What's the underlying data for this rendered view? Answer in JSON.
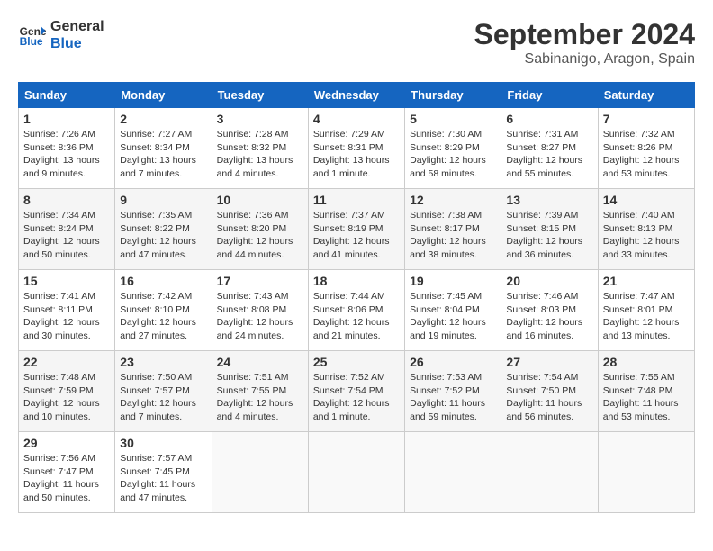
{
  "header": {
    "logo_line1": "General",
    "logo_line2": "Blue",
    "month": "September 2024",
    "location": "Sabinanigo, Aragon, Spain"
  },
  "columns": [
    "Sunday",
    "Monday",
    "Tuesday",
    "Wednesday",
    "Thursday",
    "Friday",
    "Saturday"
  ],
  "weeks": [
    [
      {
        "day": "1",
        "info": "Sunrise: 7:26 AM\nSunset: 8:36 PM\nDaylight: 13 hours\nand 9 minutes."
      },
      {
        "day": "2",
        "info": "Sunrise: 7:27 AM\nSunset: 8:34 PM\nDaylight: 13 hours\nand 7 minutes."
      },
      {
        "day": "3",
        "info": "Sunrise: 7:28 AM\nSunset: 8:32 PM\nDaylight: 13 hours\nand 4 minutes."
      },
      {
        "day": "4",
        "info": "Sunrise: 7:29 AM\nSunset: 8:31 PM\nDaylight: 13 hours\nand 1 minute."
      },
      {
        "day": "5",
        "info": "Sunrise: 7:30 AM\nSunset: 8:29 PM\nDaylight: 12 hours\nand 58 minutes."
      },
      {
        "day": "6",
        "info": "Sunrise: 7:31 AM\nSunset: 8:27 PM\nDaylight: 12 hours\nand 55 minutes."
      },
      {
        "day": "7",
        "info": "Sunrise: 7:32 AM\nSunset: 8:26 PM\nDaylight: 12 hours\nand 53 minutes."
      }
    ],
    [
      {
        "day": "8",
        "info": "Sunrise: 7:34 AM\nSunset: 8:24 PM\nDaylight: 12 hours\nand 50 minutes."
      },
      {
        "day": "9",
        "info": "Sunrise: 7:35 AM\nSunset: 8:22 PM\nDaylight: 12 hours\nand 47 minutes."
      },
      {
        "day": "10",
        "info": "Sunrise: 7:36 AM\nSunset: 8:20 PM\nDaylight: 12 hours\nand 44 minutes."
      },
      {
        "day": "11",
        "info": "Sunrise: 7:37 AM\nSunset: 8:19 PM\nDaylight: 12 hours\nand 41 minutes."
      },
      {
        "day": "12",
        "info": "Sunrise: 7:38 AM\nSunset: 8:17 PM\nDaylight: 12 hours\nand 38 minutes."
      },
      {
        "day": "13",
        "info": "Sunrise: 7:39 AM\nSunset: 8:15 PM\nDaylight: 12 hours\nand 36 minutes."
      },
      {
        "day": "14",
        "info": "Sunrise: 7:40 AM\nSunset: 8:13 PM\nDaylight: 12 hours\nand 33 minutes."
      }
    ],
    [
      {
        "day": "15",
        "info": "Sunrise: 7:41 AM\nSunset: 8:11 PM\nDaylight: 12 hours\nand 30 minutes."
      },
      {
        "day": "16",
        "info": "Sunrise: 7:42 AM\nSunset: 8:10 PM\nDaylight: 12 hours\nand 27 minutes."
      },
      {
        "day": "17",
        "info": "Sunrise: 7:43 AM\nSunset: 8:08 PM\nDaylight: 12 hours\nand 24 minutes."
      },
      {
        "day": "18",
        "info": "Sunrise: 7:44 AM\nSunset: 8:06 PM\nDaylight: 12 hours\nand 21 minutes."
      },
      {
        "day": "19",
        "info": "Sunrise: 7:45 AM\nSunset: 8:04 PM\nDaylight: 12 hours\nand 19 minutes."
      },
      {
        "day": "20",
        "info": "Sunrise: 7:46 AM\nSunset: 8:03 PM\nDaylight: 12 hours\nand 16 minutes."
      },
      {
        "day": "21",
        "info": "Sunrise: 7:47 AM\nSunset: 8:01 PM\nDaylight: 12 hours\nand 13 minutes."
      }
    ],
    [
      {
        "day": "22",
        "info": "Sunrise: 7:48 AM\nSunset: 7:59 PM\nDaylight: 12 hours\nand 10 minutes."
      },
      {
        "day": "23",
        "info": "Sunrise: 7:50 AM\nSunset: 7:57 PM\nDaylight: 12 hours\nand 7 minutes."
      },
      {
        "day": "24",
        "info": "Sunrise: 7:51 AM\nSunset: 7:55 PM\nDaylight: 12 hours\nand 4 minutes."
      },
      {
        "day": "25",
        "info": "Sunrise: 7:52 AM\nSunset: 7:54 PM\nDaylight: 12 hours\nand 1 minute."
      },
      {
        "day": "26",
        "info": "Sunrise: 7:53 AM\nSunset: 7:52 PM\nDaylight: 11 hours\nand 59 minutes."
      },
      {
        "day": "27",
        "info": "Sunrise: 7:54 AM\nSunset: 7:50 PM\nDaylight: 11 hours\nand 56 minutes."
      },
      {
        "day": "28",
        "info": "Sunrise: 7:55 AM\nSunset: 7:48 PM\nDaylight: 11 hours\nand 53 minutes."
      }
    ],
    [
      {
        "day": "29",
        "info": "Sunrise: 7:56 AM\nSunset: 7:47 PM\nDaylight: 11 hours\nand 50 minutes."
      },
      {
        "day": "30",
        "info": "Sunrise: 7:57 AM\nSunset: 7:45 PM\nDaylight: 11 hours\nand 47 minutes."
      },
      {
        "day": "",
        "info": ""
      },
      {
        "day": "",
        "info": ""
      },
      {
        "day": "",
        "info": ""
      },
      {
        "day": "",
        "info": ""
      },
      {
        "day": "",
        "info": ""
      }
    ]
  ]
}
